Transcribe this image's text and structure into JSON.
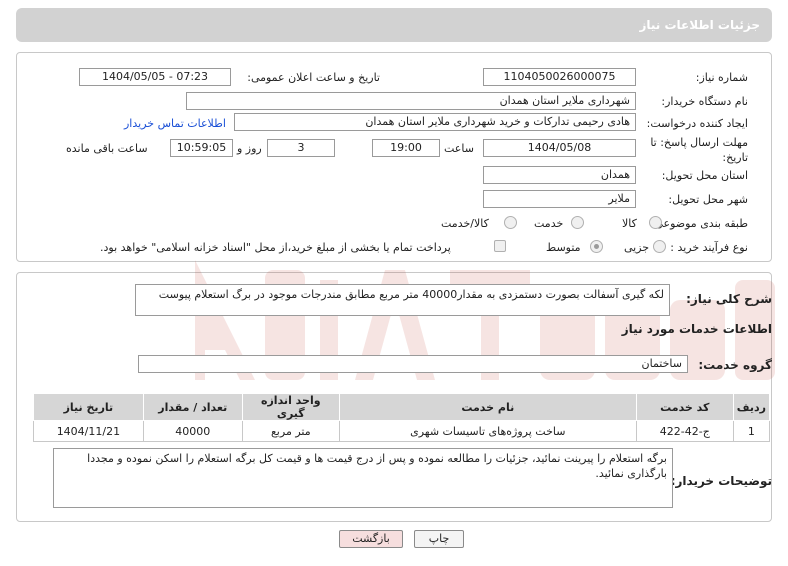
{
  "header": {
    "title": "جزئیات اطلاعات نیاز"
  },
  "form": {
    "need_number_label": "شماره نیاز:",
    "need_number": "1104050026000075",
    "announce_label": "تاریخ و ساعت اعلان عمومی:",
    "announce_value": "1404/05/05 - 07:23",
    "buyer_org_label": "نام دستگاه خریدار:",
    "buyer_org": "شهرداری ملایر استان همدان",
    "creator_label": "ایجاد کننده درخواست:",
    "creator": "هادی رحیمی تدارکات و خرید شهرداری ملایر استان همدان",
    "contact_link": "اطلاعات تماس خریدار",
    "deadline_label": "مهلت ارسال پاسخ: تا تاریخ:",
    "deadline_date": "1404/05/08",
    "time_label": "ساعت",
    "deadline_time": "19:00",
    "days_value": "3",
    "days_label": "روز و",
    "remaining_time": "10:59:05",
    "remaining_label": "ساعت باقی مانده",
    "province_label": "استان محل تحویل:",
    "province": "همدان",
    "city_label": "شهر محل تحویل:",
    "city": "ملایر",
    "category_label": "طبقه بندی موضوعی:",
    "category_options": {
      "goods": "کالا",
      "service": "خدمت",
      "goods_service": "کالا/خدمت"
    },
    "process_label": "نوع فرآیند خرید :",
    "process_options": {
      "partial": "جزیی",
      "medium": "متوسط"
    },
    "treasury_note": "پرداخت تمام یا بخشی از مبلغ خرید،از محل \"اسناد خزانه اسلامی\" خواهد بود."
  },
  "details": {
    "summary_label": "شرح کلی نیاز:",
    "summary": "لکه گیری آسفالت بصورت دستمزدی به مقدار40000 متر مربع مطابق مندرجات موجود در برگ استعلام پیوست",
    "services_title": "اطلاعات خدمات مورد نیاز",
    "service_group_label": "گروه خدمت:",
    "service_group": "ساختمان",
    "table": {
      "headers": {
        "row": "ردیف",
        "code": "کد خدمت",
        "name": "نام خدمت",
        "unit": "واحد اندازه گیری",
        "qty": "تعداد / مقدار",
        "date": "تاریخ نیاز"
      },
      "rows": [
        {
          "row": "1",
          "code": "ج-42-422",
          "name": "ساخت پروژه‌های تاسیسات شهری",
          "unit": "متر مربع",
          "qty": "40000",
          "date": "1404/11/21"
        }
      ]
    },
    "buyer_notes_label": "توضیحات خریدار:",
    "buyer_notes": "برگه استعلام را پیرینت نمائید، جزئیات را مطالعه نموده و پس از درج قیمت ها و قیمت کل برگه استعلام را اسکن نموده و مجددا بارگذاری نمائید."
  },
  "buttons": {
    "print": "چاپ",
    "back": "بازگشت"
  },
  "colors": {
    "link": "#1a4fd6",
    "header_bg": "#d2d2d2",
    "back_bg": "#f6dede"
  }
}
